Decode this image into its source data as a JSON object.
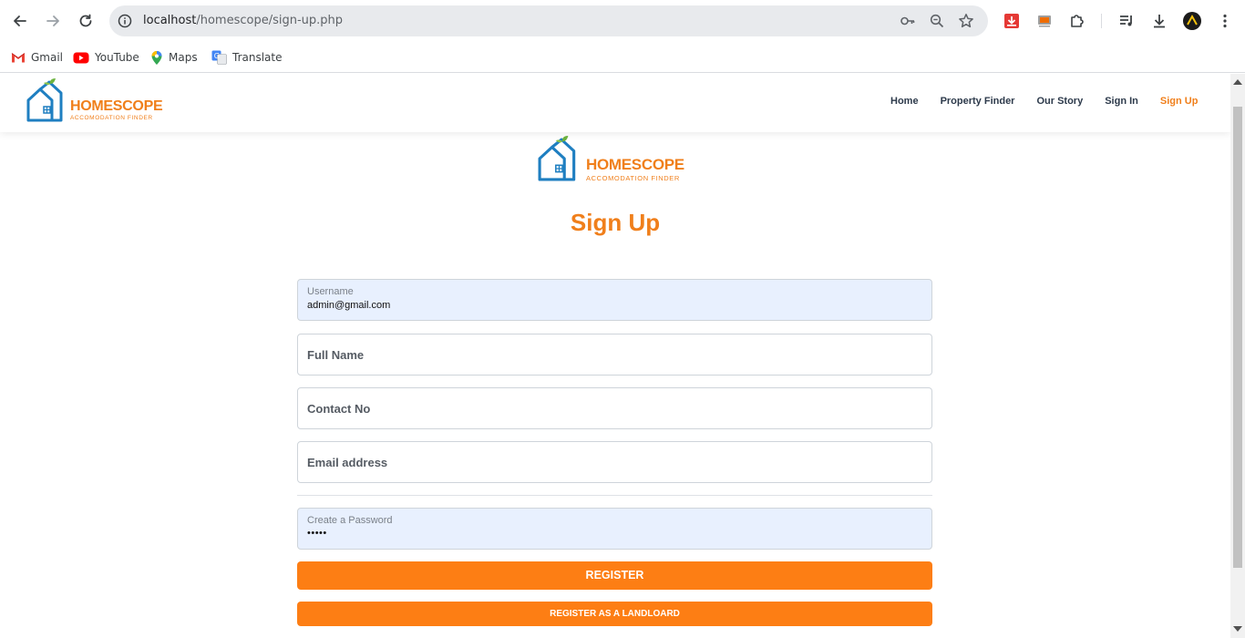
{
  "browser": {
    "url_host": "localhost",
    "url_path": "/homescope/sign-up.php",
    "bookmarks": [
      "Gmail",
      "YouTube",
      "Maps",
      "Translate"
    ]
  },
  "header": {
    "logo_title": "HOMESCOPE",
    "logo_subtitle": "ACCOMODATION FINDER",
    "nav": [
      "Home",
      "Property Finder",
      "Our Story",
      "Sign In",
      "Sign Up"
    ],
    "active_nav": "Sign Up"
  },
  "main": {
    "logo_title": "HOMESCOPE",
    "logo_subtitle": "ACCOMODATION FINDER",
    "title": "Sign Up",
    "username": {
      "label": "Username",
      "value": "admin@gmail.com"
    },
    "full_name": {
      "placeholder": "Full Name"
    },
    "contact": {
      "placeholder": "Contact No"
    },
    "email": {
      "placeholder": "Email address"
    },
    "password": {
      "label": "Create a Password",
      "value": "•••••"
    },
    "register_label": "REGISTER",
    "landlord_label": "REGISTER AS A LANDLOARD"
  },
  "colors": {
    "accent": "#f07f1b",
    "button": "#fd7e14",
    "logo_blue": "#1f7fc1",
    "leaf_green": "#6db33f"
  }
}
